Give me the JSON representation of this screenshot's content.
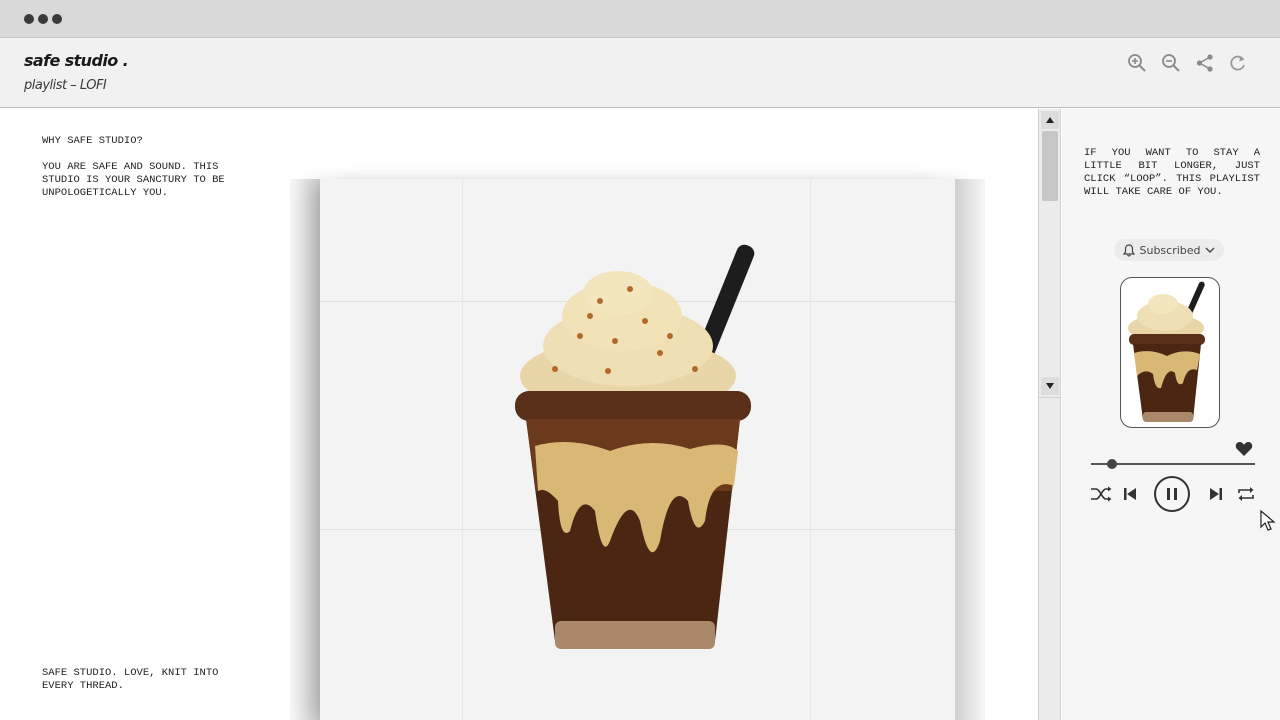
{
  "header": {
    "brand": "safe studio .",
    "subtitle": "playlist – LOFI"
  },
  "toolbar": {
    "icons": [
      "zoom-in-icon",
      "zoom-out-icon",
      "share-icon",
      "refresh-icon"
    ]
  },
  "main": {
    "heading": "WHY SAFE STUDIO?",
    "body": "YOU ARE SAFE AND SOUND. THIS STUDIO IS YOUR SANCTURY TO BE UNPOLOGETICALLY YOU.",
    "footer": "SAFE STUDIO. LOVE, KNIT INTO EVERY THREAD.",
    "artwork": "knitted frappuccino cup with whipped cream and black straw"
  },
  "panel": {
    "text": "IF YOU WANT TO STAY A LITTLE BIT LONGER, JUST CLICK “LOOP”. THIS PLAYLIST WILL TAKE CARE OF YOU.",
    "subscribe_label": "Subscribed"
  },
  "player": {
    "progress": 0.13,
    "liked": true,
    "state": "playing",
    "controls": [
      "shuffle-icon",
      "previous-icon",
      "pause-icon",
      "next-icon",
      "loop-icon"
    ]
  },
  "colors": {
    "chrome": "#d9d9d9",
    "header_bg": "#f1f1f1",
    "panel_bg": "#f6f6f6",
    "accent_dark": "#3a3a3a"
  }
}
